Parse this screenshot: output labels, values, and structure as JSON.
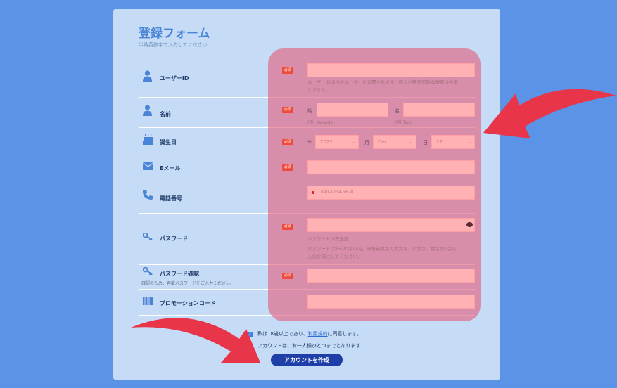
{
  "form": {
    "title": "登録フォーム",
    "subtitle": "半角英数字で入力してください",
    "required_badge": "必須",
    "rows": {
      "userid": {
        "label": "ユーザーID",
        "hint": [
          "ユーザーIDは他のユーザーに公開されます。個人が特定可能な情報は推奨",
          "しません。"
        ]
      },
      "name": {
        "label": "名前",
        "last_label": "姓",
        "last_example": "(例) Yamada",
        "first_label": "名",
        "first_example": "(例) Taro"
      },
      "birthday": {
        "label": "誕生日",
        "year_label": "年",
        "year_value": "2022",
        "month_label": "月",
        "month_value": "Dec",
        "day_label": "日",
        "day_value": "27"
      },
      "email": {
        "label": "Eメール"
      },
      "phone": {
        "label": "電話番号",
        "placeholder": "090-1234-5678"
      },
      "password": {
        "label": "パスワード",
        "strength": "パスワードの安全度",
        "rule": [
          "パスワードは8〜20字以内。半角英数字で大文字、小文字、数字が1字以",
          "上含む形にしてください。"
        ]
      },
      "password_confirm": {
        "label": "パスワード確認",
        "note": "確認のため、再度パスワードをご入力ください。"
      },
      "promo": {
        "label": "プロモーションコード"
      }
    },
    "agree_before": "私は18歳以上であり、",
    "agree_link": "利用規約",
    "agree_after": "に同意します。",
    "once_note": "アカウントは、お一人様ひとつまでとなります",
    "submit_label": "アカウントを作成"
  },
  "colors": {
    "background": "#5b93e6",
    "card": "#c6dcf6",
    "overlay": "#e45e7a",
    "required": "#ef4a3a",
    "submit": "#1e3fa8",
    "arrow": "#e8354a"
  },
  "icons": [
    "user-icon",
    "user-icon",
    "cake-icon",
    "mail-icon",
    "phone-icon",
    "key-icon",
    "key-icon",
    "barcode-icon",
    "eye-icon"
  ]
}
